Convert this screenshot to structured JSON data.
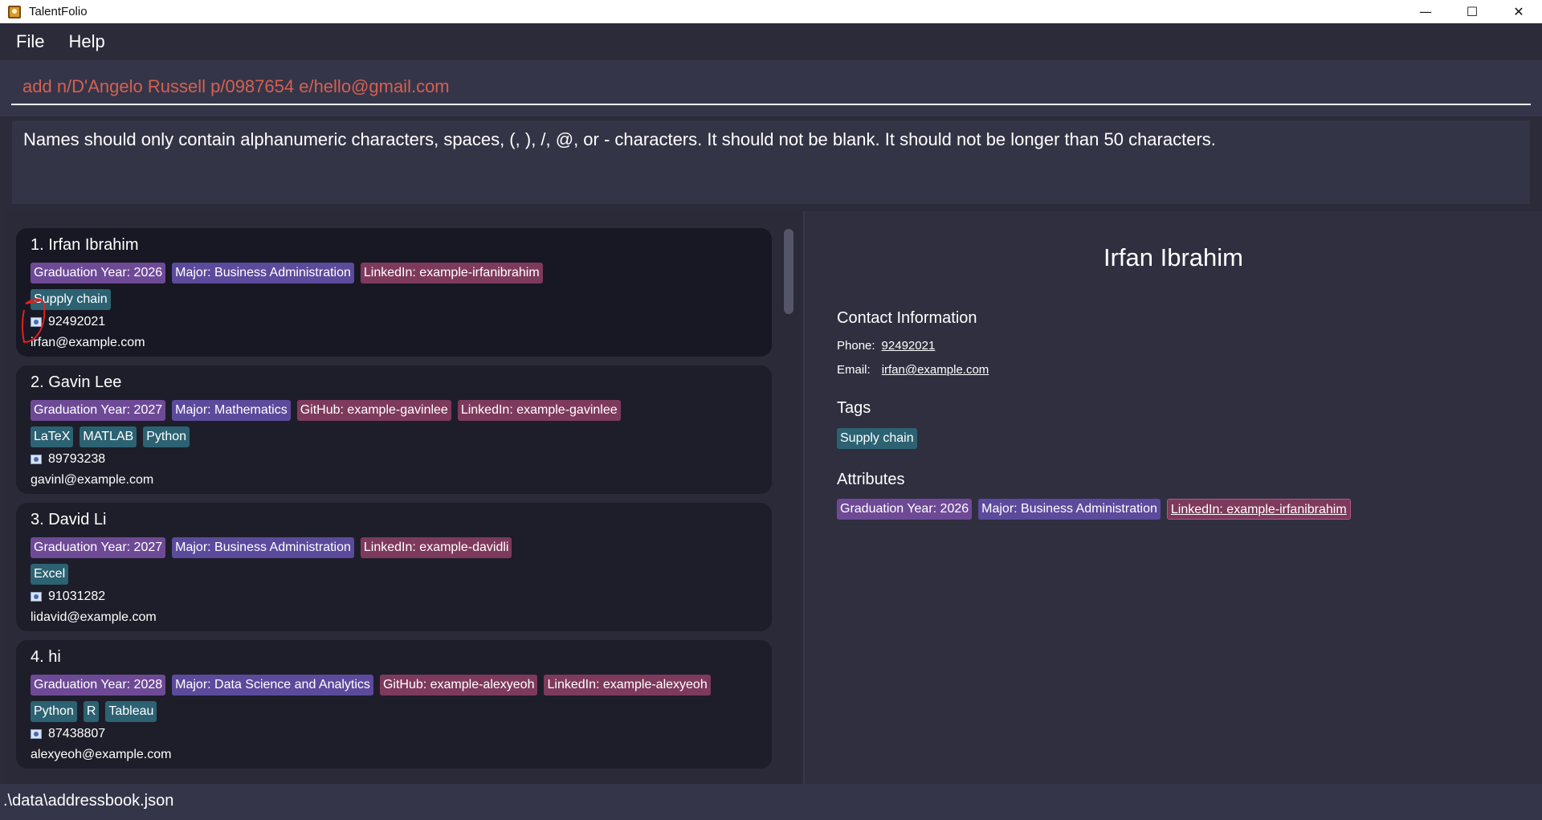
{
  "window": {
    "title": "TalentFolio",
    "controls": [
      "—",
      "☐",
      "✕"
    ]
  },
  "menu": [
    "File",
    "Help"
  ],
  "command": {
    "value": "add n/D'Angelo Russell p/0987654 e/hello@gmail.com"
  },
  "result": {
    "message": "Names should only contain alphanumeric characters, spaces, (, ), /, @, or - characters. It should not be blank. It should not be longer than 50 characters."
  },
  "persons": [
    {
      "name": "1. Irfan Ibrahim",
      "attributes": [
        "Graduation Year: 2026",
        "Major: Business Administration",
        "LinkedIn: example-irfanibrahim"
      ],
      "tags": [
        "Supply chain"
      ],
      "phone": "92492021",
      "email": "irfan@example.com"
    },
    {
      "name": "2. Gavin Lee",
      "attributes": [
        "Graduation Year: 2027",
        "Major: Mathematics",
        "GitHub: example-gavinlee",
        "LinkedIn: example-gavinlee"
      ],
      "tags": [
        "LaTeX",
        "MATLAB",
        "Python"
      ],
      "phone": "89793238",
      "email": "gavinl@example.com"
    },
    {
      "name": "3. David Li",
      "attributes": [
        "Graduation Year: 2027",
        "Major: Business Administration",
        "LinkedIn: example-davidli"
      ],
      "tags": [
        "Excel"
      ],
      "phone": "91031282",
      "email": "lidavid@example.com"
    },
    {
      "name": "4. hi",
      "attributes": [
        "Graduation Year: 2028",
        "Major: Data Science and Analytics",
        "GitHub: example-alexyeoh",
        "LinkedIn: example-alexyeoh"
      ],
      "tags": [
        "Python",
        "R",
        "Tableau"
      ],
      "phone": "87438807",
      "email": "alexyeoh@example.com"
    }
  ],
  "detail": {
    "name": "Irfan Ibrahim",
    "contact_title": "Contact Information",
    "phone_label": "Phone:",
    "phone": "92492021",
    "email_label": "Email:",
    "email": "irfan@example.com",
    "tags_title": "Tags",
    "tags": [
      "Supply chain"
    ],
    "attributes_title": "Attributes",
    "attributes": [
      "Graduation Year: 2026",
      "Major: Business Administration",
      "LinkedIn: example-irfanibrahim"
    ]
  },
  "status": {
    "path": ".\\data\\addressbook.json"
  },
  "colors": {
    "command_text": "#d5614f",
    "graduation_tag": "#6e4a96",
    "major_tag": "#5c4a9c",
    "link_tag": "#7e3a5c",
    "skill_tag": "#2c6272",
    "annotation": "#e02020"
  },
  "icons": {
    "phone": "phone-icon",
    "app": "app-icon"
  }
}
